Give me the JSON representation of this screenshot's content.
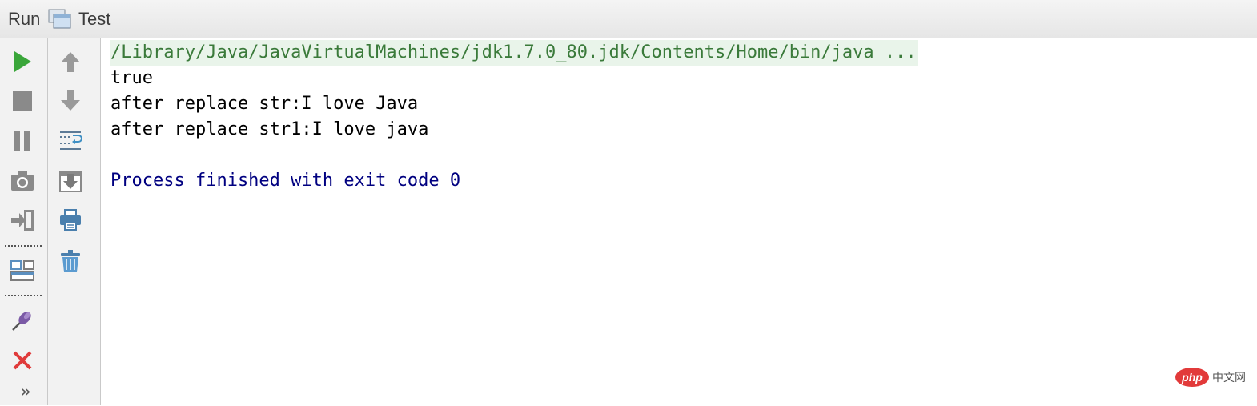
{
  "header": {
    "run_label": "Run",
    "config_icon": "run-configuration-icon",
    "tab_label": "Test"
  },
  "left_toolbar": [
    {
      "icon": "rerun-icon",
      "color": "#3aa63a"
    },
    {
      "icon": "stop-icon",
      "color": "#8a8a8a"
    },
    {
      "icon": "pause-icon",
      "color": "#8a8a8a"
    },
    {
      "icon": "camera-icon",
      "color": "#8a8a8a"
    },
    {
      "icon": "exit-icon",
      "color": "#8a8a8a"
    },
    {
      "icon": "restore-layout-icon",
      "color": "#5b8fbf"
    },
    {
      "icon": "pin-icon",
      "color": "#7b5aa6"
    },
    {
      "icon": "close-icon",
      "color": "#e03b3b"
    },
    {
      "icon": "more-icon",
      "color": "#555555",
      "label": "»"
    }
  ],
  "right_toolbar": [
    {
      "icon": "up-arrow-icon"
    },
    {
      "icon": "down-arrow-icon"
    },
    {
      "icon": "soft-wrap-icon"
    },
    {
      "icon": "scroll-to-end-icon"
    },
    {
      "icon": "print-icon"
    },
    {
      "icon": "trash-icon"
    }
  ],
  "console": {
    "command": "/Library/Java/JavaVirtualMachines/jdk1.7.0_80.jdk/Contents/Home/bin/java ...",
    "lines": [
      "true",
      "after replace str:I love Java",
      "after replace str1:I love java"
    ],
    "exit_message": "Process finished with exit code 0"
  },
  "watermark": {
    "badge": "php",
    "text": "中文网"
  },
  "colors": {
    "command_text": "#3a7a3a",
    "command_bg": "#e9f4ea",
    "exit_text": "#000080"
  }
}
